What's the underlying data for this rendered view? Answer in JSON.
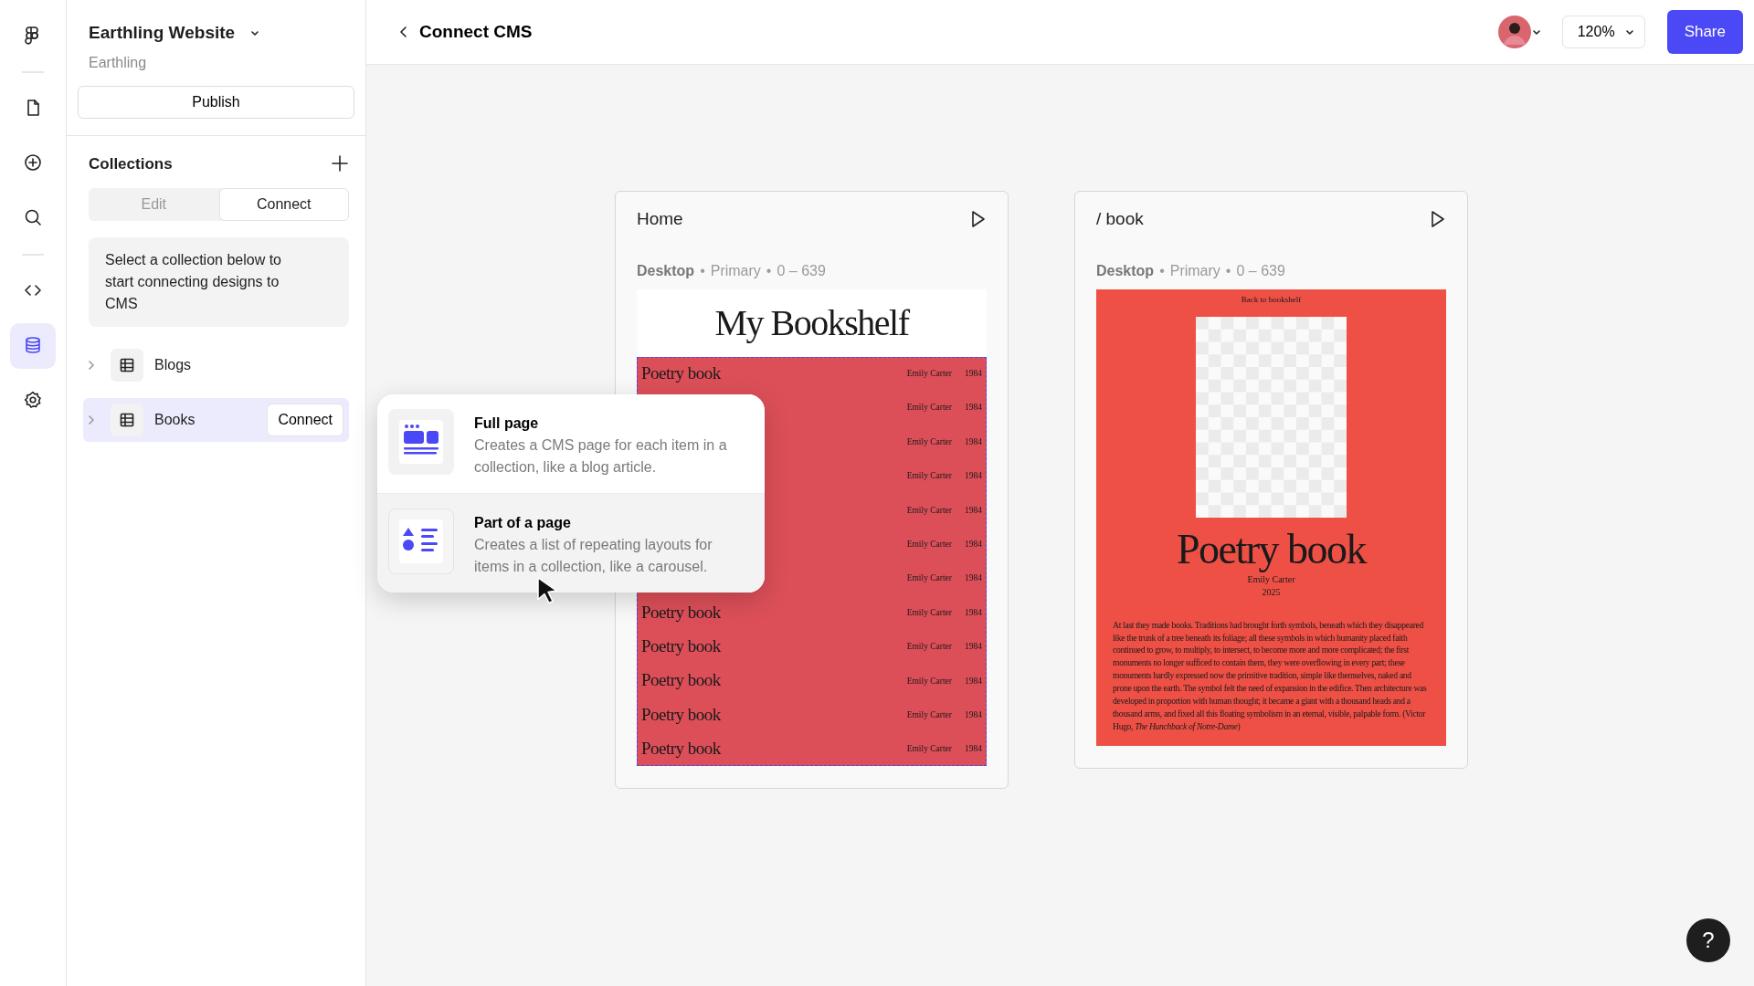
{
  "rail": {
    "items": [
      {
        "kind": "logo",
        "selected": false
      },
      {
        "kind": "page",
        "selected": false
      },
      {
        "kind": "add",
        "selected": false
      },
      {
        "kind": "search",
        "selected": false
      },
      {
        "kind": "code",
        "selected": false
      },
      {
        "kind": "database",
        "selected": true
      },
      {
        "kind": "settings",
        "selected": false
      }
    ]
  },
  "sidebar": {
    "project": {
      "title": "Earthling Website",
      "subtitle": "Earthling"
    },
    "publish_button": "Publish",
    "collections": {
      "title": "Collections",
      "tabs": [
        {
          "label": "Edit",
          "selected": false
        },
        {
          "label": "Connect",
          "selected": true
        }
      ],
      "hint": "Select a collection below to start connecting designs to CMS",
      "items": [
        {
          "name": "Blogs",
          "selected": false
        },
        {
          "name": "Books",
          "selected": true,
          "action": "Connect"
        }
      ]
    }
  },
  "topbar": {
    "back_title": "Connect CMS",
    "zoom": "120%",
    "share": "Share"
  },
  "frames": [
    {
      "kind": "list",
      "title": "Home",
      "meta": [
        "Desktop",
        "•",
        "Primary",
        "•",
        "0 – 639"
      ],
      "heading": "My Bookshelf",
      "rows": [
        {
          "title": "Poetry book",
          "author": "Emily Carter",
          "year": "1984"
        },
        {
          "author": "Emily Carter",
          "year": "1984"
        },
        {
          "author": "Emily Carter",
          "year": "1984"
        },
        {
          "author": "Emily Carter",
          "year": "1984"
        },
        {
          "author": "Emily Carter",
          "year": "1984"
        },
        {
          "author": "Emily Carter",
          "year": "1984"
        },
        {
          "author": "Emily Carter",
          "year": "1984"
        },
        {
          "title": "Poetry book",
          "author": "Emily Carter",
          "year": "1984"
        },
        {
          "title": "Poetry book",
          "author": "Emily Carter",
          "year": "1984"
        },
        {
          "title": "Poetry book",
          "author": "Emily Carter",
          "year": "1984"
        },
        {
          "title": "Poetry book",
          "author": "Emily Carter",
          "year": "1984"
        },
        {
          "title": "Poetry book",
          "author": "Emily Carter",
          "year": "1984"
        }
      ]
    },
    {
      "kind": "detail",
      "title": "/ book",
      "meta": [
        "Desktop",
        "•",
        "Primary",
        "•",
        "0 – 639"
      ],
      "back_link": "Back to bookshelf",
      "book_title": "Poetry book",
      "author": "Emily Carter",
      "year": "2025",
      "body": "At last they made books. Traditions had brought forth symbols, beneath which they disappeared like the trunk of a tree beneath its foliage; all these symbols in which humanity placed faith continued to grow, to multiply, to intersect, to become more and more complicated; the first monuments no longer sufficed to contain them, they were overflowing in every part; these monuments hardly expressed now the primitive tradition, simple like themselves, naked and prone upon the earth. The symbol felt the need of expansion in the edifice. Then architecture was developed in proportion with human thought; it became a giant with a thousand heads and a thousand arms, and fixed all this floating symbolism in an eternal, visible, palpable form. (Victor Hugo, *The Hunchback of Notre-Dame*)"
    }
  ],
  "popup": {
    "options": [
      {
        "kind": "full",
        "title": "Full page",
        "description": "Creates a CMS page for each item in a collection, like a blog article.",
        "selected": false
      },
      {
        "kind": "part",
        "title": "Part of a page",
        "description": "Creates a list of repeating layouts for items in a collection, like a carousel.",
        "selected": true
      }
    ]
  },
  "help_button": "?"
}
